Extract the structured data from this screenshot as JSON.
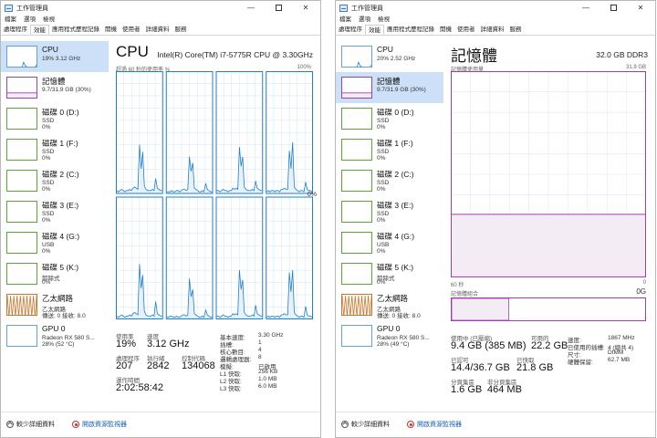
{
  "window": {
    "title": "工作管理員",
    "min_glyph": "—",
    "close_glyph": "✕"
  },
  "menu": [
    "檔案",
    "選項",
    "檢視"
  ],
  "tabs": [
    "處理程序",
    "效能",
    "應用程式歷程記錄",
    "開機",
    "使用者",
    "詳細資料",
    "服務"
  ],
  "left": {
    "sidebar": [
      {
        "title": "CPU",
        "line1": "19% 3.12 GHz",
        "line2": ""
      },
      {
        "title": "記憶體",
        "line1": "9.7/31.9 GB (30%)",
        "line2": ""
      },
      {
        "title": "磁碟 0 (D:)",
        "line1": "SSD",
        "line2": "0%"
      },
      {
        "title": "磁碟 1 (F:)",
        "line1": "SSD",
        "line2": "0%"
      },
      {
        "title": "磁碟 2 (C:)",
        "line1": "SSD",
        "line2": "0%"
      },
      {
        "title": "磁碟 3 (E:)",
        "line1": "SSD",
        "line2": "0%"
      },
      {
        "title": "磁碟 4 (G:)",
        "line1": "USB",
        "line2": "0%"
      },
      {
        "title": "磁碟 5 (K:)",
        "line1": "卸除式",
        "line2": "0%"
      },
      {
        "title": "乙太網路",
        "line1": "乙太網路",
        "line2": "傳送: 0 接收: 8.0"
      },
      {
        "title": "GPU 0",
        "line1": "Radeon RX 580 S...",
        "line2": "28% (52 °C)"
      }
    ],
    "main": {
      "heading": "CPU",
      "model": "Intel(R) Core(TM) i7-5775R CPU @ 3.30GHz",
      "axis_left": "超過 60 秒的使用率 %",
      "axis_right": "100%",
      "zero_label": "0%",
      "usage_label": "使用率",
      "usage_value": "19%",
      "speed_label": "速度",
      "speed_value": "3.12 GHz",
      "process_label": "處理程序",
      "process_value": "207",
      "thread_label": "執行緒",
      "thread_value": "2842",
      "handle_label": "控制代碼",
      "handle_value": "134068",
      "uptime_label": "運作時間",
      "uptime_value": "2:02:58:42",
      "specs": [
        {
          "k": "基本速度:",
          "v": "3.30 GHz"
        },
        {
          "k": "插槽:",
          "v": "1"
        },
        {
          "k": "核心數目:",
          "v": "4"
        },
        {
          "k": "邏輯處理器:",
          "v": "8"
        },
        {
          "k": "模擬:",
          "v": "已啟用"
        },
        {
          "k": "L1 快取:",
          "v": "256 KB"
        },
        {
          "k": "L2 快取:",
          "v": "1.0 MB"
        },
        {
          "k": "L3 快取:",
          "v": "6.0 MB"
        }
      ]
    }
  },
  "right": {
    "sidebar": [
      {
        "title": "CPU",
        "line1": "20% 2.52 GHz",
        "line2": ""
      },
      {
        "title": "記憶體",
        "line1": "9.7/31.9 GB (30%)",
        "line2": ""
      },
      {
        "title": "磁碟 0 (D:)",
        "line1": "SSD",
        "line2": "0%"
      },
      {
        "title": "磁碟 1 (F:)",
        "line1": "SSD",
        "line2": "0%"
      },
      {
        "title": "磁碟 2 (C:)",
        "line1": "SSD",
        "line2": "0%"
      },
      {
        "title": "磁碟 3 (E:)",
        "line1": "SSD",
        "line2": "0%"
      },
      {
        "title": "磁碟 4 (G:)",
        "line1": "USB",
        "line2": "0%"
      },
      {
        "title": "磁碟 5 (K:)",
        "line1": "卸除式",
        "line2": "0%"
      },
      {
        "title": "乙太網路",
        "line1": "乙太網路",
        "line2": "傳送: 0 接收: 8.0"
      },
      {
        "title": "GPU 0",
        "line1": "Radeon RX 580 S...",
        "line2": "28% (49 °C)"
      }
    ],
    "main": {
      "heading": "記憶體",
      "model": "32.0 GB DDR3",
      "axis_left": "記憶體使用量",
      "axis_right": "31.9 GB",
      "time_label": "60 秒",
      "zero_label": "0",
      "zero_g": "0G",
      "composition_label": "記憶體組合",
      "inuse_label": "使用中 (已壓縮)",
      "inuse_value": "9.4 GB (385 MB)",
      "avail_label": "可用的",
      "avail_value": "22.2 GB",
      "committed_label": "已認可",
      "committed_value": "14.4/36.7 GB",
      "cached_label": "已快取",
      "cached_value": "21.8 GB",
      "paged_label": "分頁集區",
      "paged_value": "1.6 GB",
      "nonpaged_label": "非分頁集區",
      "nonpaged_value": "464 MB",
      "specs": [
        {
          "k": "速度:",
          "v": "1867 MHz"
        },
        {
          "k": "已使用的插槽:",
          "v": "4 (總共 4)"
        },
        {
          "k": "尺寸:",
          "v": "DIMM"
        },
        {
          "k": "硬體保留:",
          "v": "62.7 MB"
        }
      ]
    }
  },
  "footer": {
    "less_details": "較少詳細資料",
    "open_monitor": "開啟資源監視器"
  },
  "colors": {
    "cpu": "#1f7fcf",
    "cpu_fill": "#e6f1fb",
    "memory": "#9c41a6",
    "memory_fill": "#f4ecf5",
    "disk": "#5aa63b",
    "network": "#c9762f",
    "selection": "#cce1f7"
  },
  "chart_data": [
    {
      "type": "area",
      "title": "CPU",
      "ylabel": "超過 60 秒的使用率 %",
      "ylim": [
        0,
        100
      ],
      "series": [
        {
          "name": "",
          "values": [
            2,
            1,
            2,
            3,
            2,
            1,
            2,
            2,
            3,
            2,
            4,
            5,
            4,
            3,
            40,
            20,
            34,
            6,
            3,
            2,
            2,
            2,
            3,
            2,
            12,
            4,
            3,
            2,
            2
          ]
        },
        {
          "name": "",
          "values": [
            1,
            1,
            1,
            2,
            1,
            1,
            2,
            2,
            1,
            2,
            3,
            3,
            2,
            3,
            30,
            18,
            25,
            4,
            3,
            2,
            1,
            1,
            2,
            1,
            8,
            3,
            2,
            1,
            1
          ]
        },
        {
          "name": "",
          "values": [
            2,
            2,
            1,
            2,
            3,
            2,
            2,
            1,
            2,
            2,
            4,
            3,
            4,
            3,
            38,
            22,
            30,
            5,
            3,
            2,
            2,
            2,
            3,
            2,
            10,
            4,
            3,
            2,
            2
          ]
        },
        {
          "name": "",
          "values": [
            1,
            2,
            1,
            2,
            2,
            1,
            2,
            2,
            1,
            3,
            3,
            4,
            3,
            3,
            35,
            20,
            42,
            5,
            3,
            2,
            1,
            2,
            2,
            1,
            9,
            3,
            2,
            2,
            1
          ]
        },
        {
          "name": "",
          "values": [
            2,
            1,
            2,
            3,
            2,
            1,
            2,
            2,
            3,
            2,
            4,
            5,
            4,
            3,
            45,
            25,
            36,
            6,
            3,
            2,
            2,
            2,
            3,
            2,
            14,
            4,
            3,
            2,
            2
          ]
        },
        {
          "name": "",
          "values": [
            1,
            1,
            2,
            2,
            1,
            1,
            2,
            1,
            1,
            2,
            3,
            3,
            2,
            3,
            33,
            18,
            24,
            4,
            3,
            2,
            1,
            1,
            2,
            1,
            7,
            3,
            2,
            1,
            1
          ]
        },
        {
          "name": "",
          "values": [
            2,
            2,
            1,
            2,
            3,
            2,
            2,
            1,
            2,
            2,
            4,
            3,
            4,
            3,
            40,
            24,
            32,
            5,
            3,
            2,
            2,
            2,
            3,
            2,
            11,
            4,
            3,
            2,
            2
          ]
        },
        {
          "name": "",
          "values": [
            1,
            2,
            1,
            2,
            2,
            1,
            2,
            2,
            1,
            3,
            3,
            4,
            3,
            3,
            38,
            22,
            40,
            5,
            3,
            2,
            1,
            2,
            2,
            1,
            10,
            3,
            2,
            2,
            1
          ]
        }
      ]
    },
    {
      "type": "area",
      "title": "記憶體",
      "ylabel": "記憶體使用量",
      "ylim": [
        0,
        31.9
      ],
      "series": [
        {
          "name": "",
          "values": [
            9.7,
            9.7,
            9.7,
            9.7,
            9.7,
            9.7,
            9.7,
            9.7,
            9.7,
            9.7,
            9.7,
            9.7,
            9.7,
            9.7,
            9.7,
            9.7,
            9.7,
            9.7,
            9.7,
            9.7
          ]
        }
      ]
    }
  ],
  "thumbnails": {
    "cpu": [
      4,
      3,
      5,
      4,
      6,
      5,
      4,
      7,
      5,
      4,
      30,
      12,
      8,
      5,
      4,
      6,
      5,
      4,
      18,
      6
    ],
    "gpu": [
      3,
      4,
      3,
      5,
      4,
      3,
      4,
      5,
      3,
      4,
      6,
      4,
      3,
      5,
      4,
      3,
      4,
      5,
      3,
      4
    ],
    "net": [
      100,
      0,
      100,
      0,
      100,
      0,
      100,
      0,
      100,
      0,
      100,
      0,
      100,
      0,
      100,
      0,
      100,
      0,
      100,
      0
    ]
  }
}
